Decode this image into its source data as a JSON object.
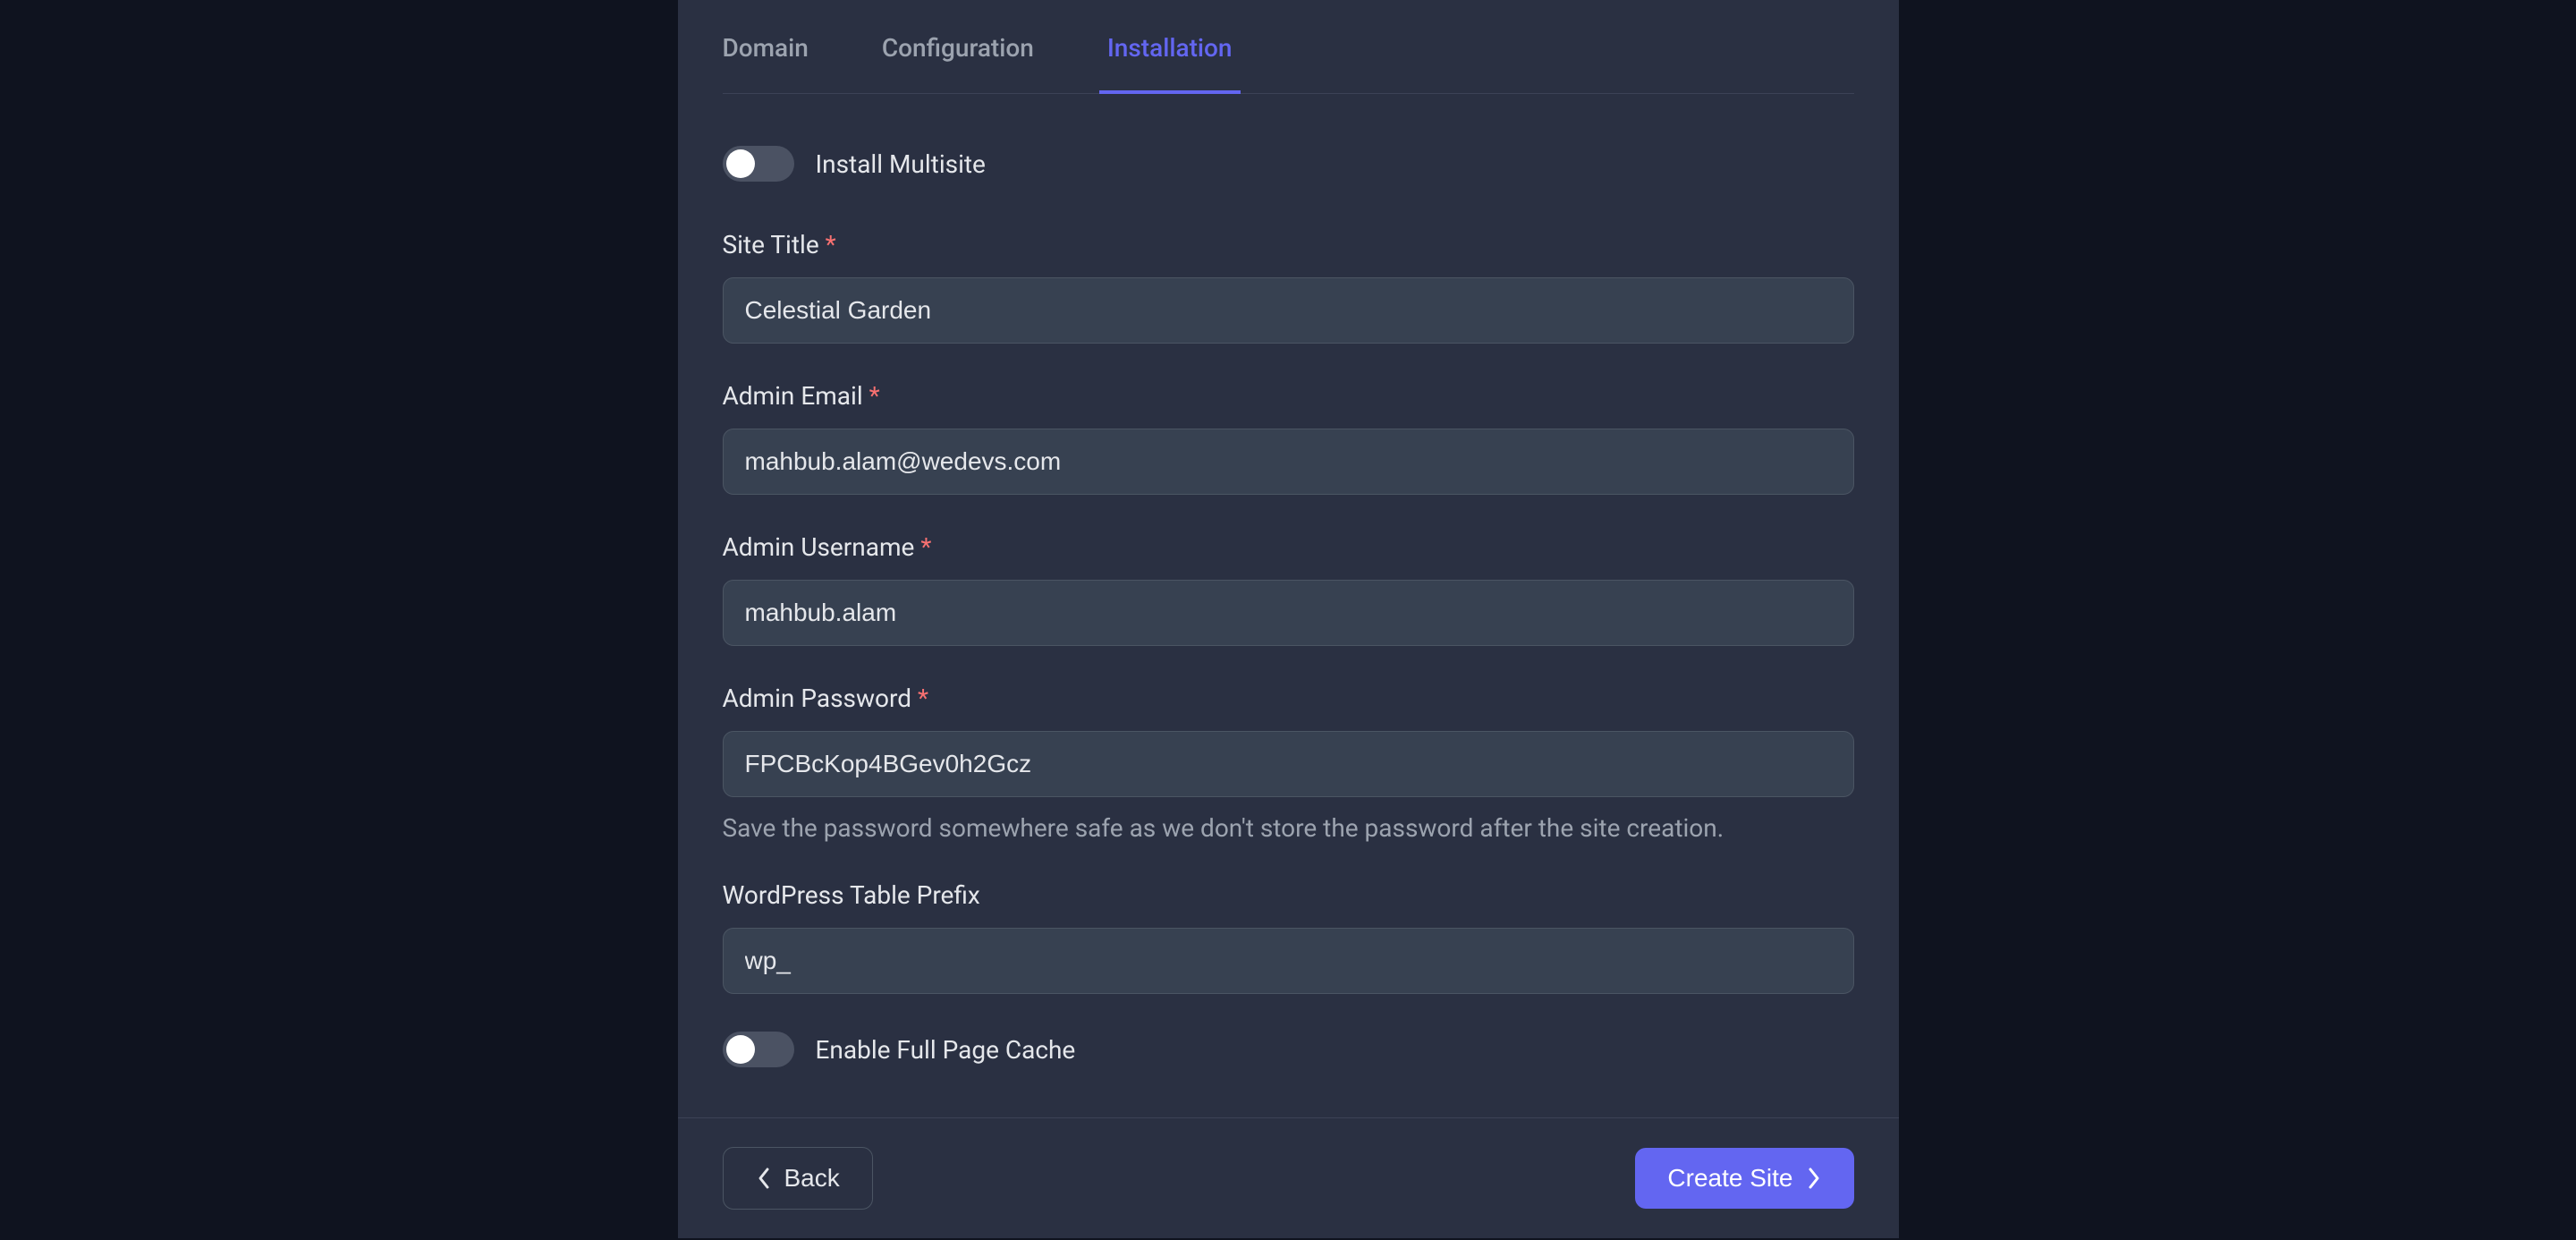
{
  "tabs": {
    "domain": "Domain",
    "configuration": "Configuration",
    "installation": "Installation"
  },
  "toggles": {
    "multisite_label": "Install Multisite",
    "cache_label": "Enable Full Page Cache"
  },
  "fields": {
    "site_title": {
      "label": "Site Title",
      "value": "Celestial Garden"
    },
    "admin_email": {
      "label": "Admin Email",
      "value": "mahbub.alam@wedevs.com"
    },
    "admin_username": {
      "label": "Admin Username",
      "value": "mahbub.alam"
    },
    "admin_password": {
      "label": "Admin Password",
      "value": "FPCBcKop4BGev0h2Gcz",
      "help": "Save the password somewhere safe as we don't store the password after the site creation."
    },
    "table_prefix": {
      "label": "WordPress Table Prefix",
      "value": "wp_"
    }
  },
  "required_mark": "*",
  "buttons": {
    "back": "Back",
    "create": "Create Site"
  }
}
